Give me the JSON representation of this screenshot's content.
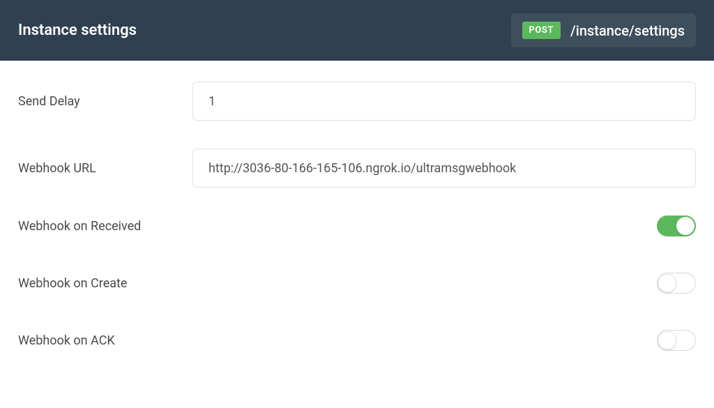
{
  "header": {
    "title": "Instance settings",
    "method": "POST",
    "endpoint": "/instance/settings"
  },
  "form": {
    "send_delay": {
      "label": "Send Delay",
      "value": "1"
    },
    "webhook_url": {
      "label": "Webhook URL",
      "value": "http://3036-80-166-165-106.ngrok.io/ultramsgwebhook"
    },
    "webhook_received": {
      "label": "Webhook on Received",
      "enabled": true
    },
    "webhook_create": {
      "label": "Webhook on Create",
      "enabled": false
    },
    "webhook_ack": {
      "label": "Webhook on ACK",
      "enabled": false
    }
  }
}
